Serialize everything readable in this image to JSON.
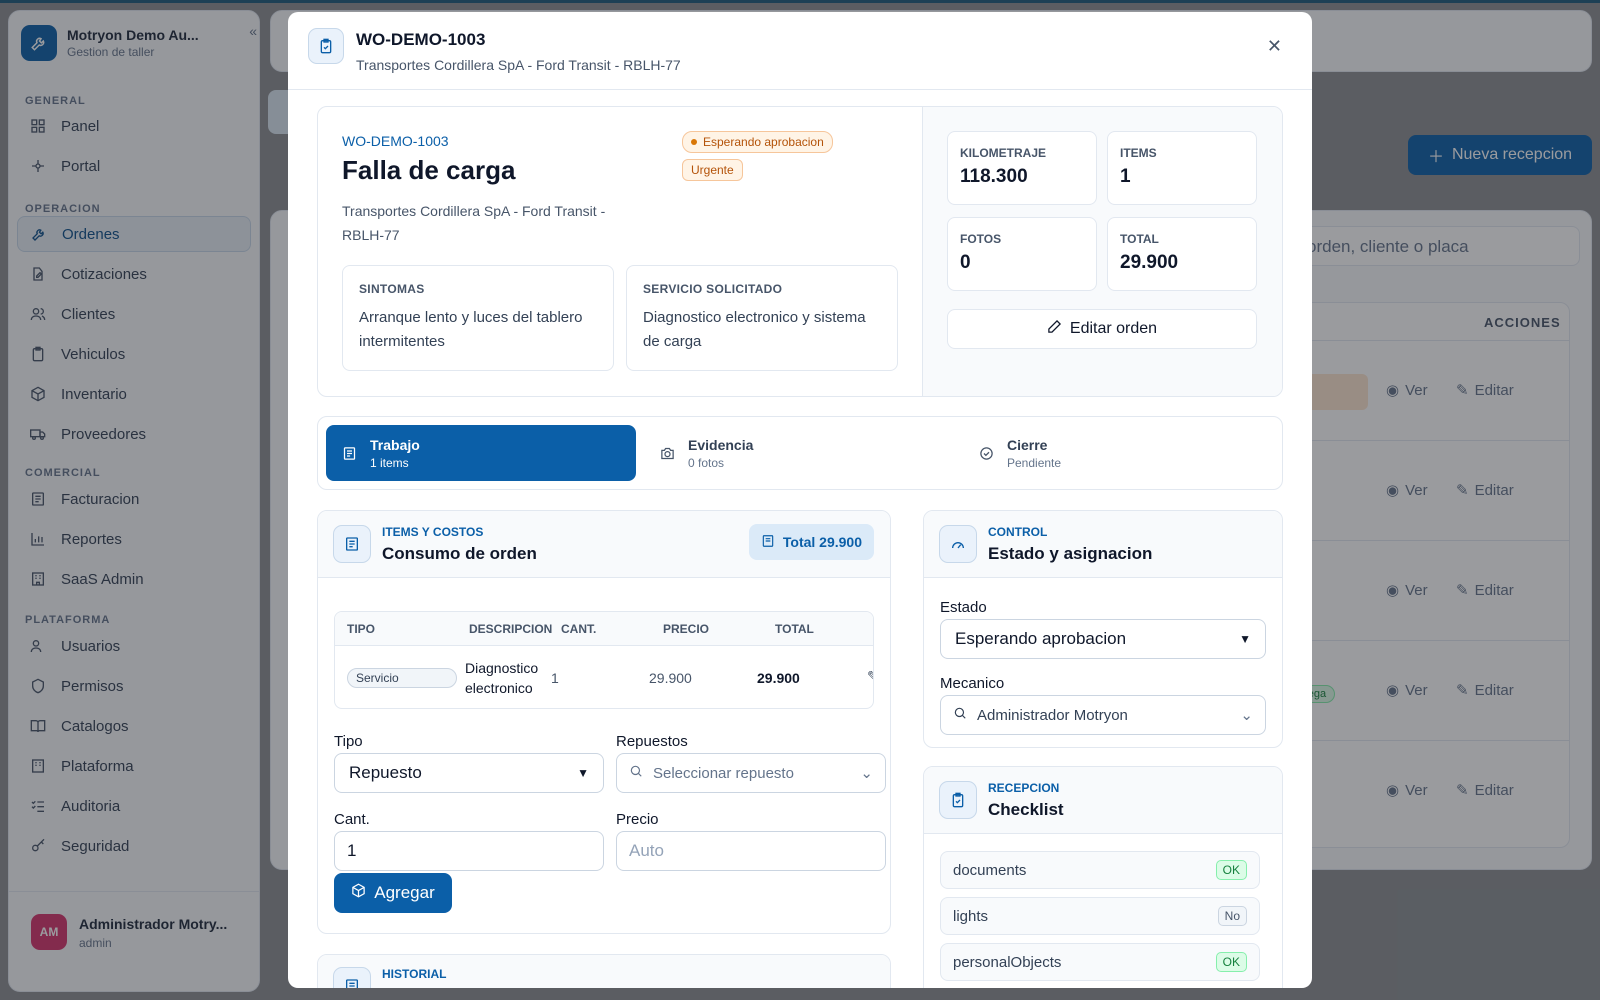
{
  "app": {
    "brand_title": "Motryon Demo Au...",
    "brand_subtitle": "Gestion de taller"
  },
  "sidebar": {
    "sections": [
      {
        "label": "GENERAL"
      },
      {
        "label": "OPERACION"
      },
      {
        "label": "COMERCIAL"
      },
      {
        "label": "PLATAFORMA"
      }
    ],
    "items": [
      {
        "label": "Panel",
        "icon": "grid-icon"
      },
      {
        "label": "Portal",
        "icon": "network-icon"
      },
      {
        "label": "Ordenes",
        "icon": "wrench-icon",
        "active": true
      },
      {
        "label": "Cotizaciones",
        "icon": "document-edit-icon"
      },
      {
        "label": "Clientes",
        "icon": "users-icon"
      },
      {
        "label": "Vehiculos",
        "icon": "clipboard-icon"
      },
      {
        "label": "Inventario",
        "icon": "box-icon"
      },
      {
        "label": "Proveedores",
        "icon": "truck-icon"
      },
      {
        "label": "Facturacion",
        "icon": "receipt-icon"
      },
      {
        "label": "Reportes",
        "icon": "bar-chart-icon"
      },
      {
        "label": "SaaS Admin",
        "icon": "building-icon"
      },
      {
        "label": "Usuarios",
        "icon": "users-icon"
      },
      {
        "label": "Permisos",
        "icon": "shield-icon"
      },
      {
        "label": "Catalogos",
        "icon": "book-icon"
      },
      {
        "label": "Plataforma",
        "icon": "building-icon"
      },
      {
        "label": "Auditoria",
        "icon": "list-check-icon"
      },
      {
        "label": "Seguridad",
        "icon": "key-icon"
      }
    ],
    "user": {
      "initials": "AM",
      "name": "Administrador Motry...",
      "role": "admin"
    }
  },
  "background": {
    "new_button": "Nueva recepcion",
    "search_placeholder": "orden, cliente o placa",
    "actions_header": "ACCIONES",
    "view_label": "Ver",
    "edit_label": "Editar",
    "green_badge": "trega"
  },
  "modal": {
    "title": "WO-DEMO-1003",
    "subtitle": "Transportes Cordillera SpA - Ford Transit - RBLH-77",
    "summary": {
      "code": "WO-DEMO-1003",
      "title": "Falla de carga",
      "description": "Transportes Cordillera SpA - Ford Transit - RBLH-77",
      "status_badge": "Esperando aprobacion",
      "priority_badge": "Urgente",
      "symptoms_label": "SINTOMAS",
      "symptoms_text": "Arranque lento y luces del tablero intermitentes",
      "service_label": "SERVICIO SOLICITADO",
      "service_text": "Diagnostico electronico y sistema de carga",
      "stats": {
        "km_label": "KILOMETRAJE",
        "km_value": "118.300",
        "items_label": "ITEMS",
        "items_value": "1",
        "photos_label": "FOTOS",
        "photos_value": "0",
        "total_label": "TOTAL",
        "total_value": "29.900"
      },
      "edit_button": "Editar orden"
    },
    "tabs": [
      {
        "label": "Trabajo",
        "sub": "1 items"
      },
      {
        "label": "Evidencia",
        "sub": "0 fotos"
      },
      {
        "label": "Cierre",
        "sub": "Pendiente"
      }
    ],
    "items_panel": {
      "kicker": "ITEMS Y COSTOS",
      "title": "Consumo de orden",
      "total_pill": "Total 29.900",
      "columns": [
        "TIPO",
        "DESCRIPCION",
        "CANT.",
        "PRECIO",
        "TOTAL"
      ],
      "rows": [
        {
          "tipo": "Servicio",
          "descripcion_1": "Diagnostico",
          "descripcion_2": "electronico",
          "cant": "1",
          "precio": "29.900",
          "total": "29.900"
        }
      ],
      "form": {
        "tipo_label": "Tipo",
        "tipo_value": "Repuesto",
        "repuestos_label": "Repuestos",
        "repuestos_placeholder": "Seleccionar repuesto",
        "cant_label": "Cant.",
        "cant_value": "1",
        "precio_label": "Precio",
        "precio_placeholder": "Auto",
        "add_button": "Agregar"
      }
    },
    "history_panel": {
      "kicker": "HISTORIAL"
    },
    "control_panel": {
      "kicker": "CONTROL",
      "title": "Estado y asignacion",
      "estado_label": "Estado",
      "estado_value": "Esperando aprobacion",
      "mecanico_label": "Mecanico",
      "mecanico_value": "Administrador Motryon"
    },
    "checklist_panel": {
      "kicker": "RECEPCION",
      "title": "Checklist",
      "items": [
        {
          "label": "documents",
          "status": "OK"
        },
        {
          "label": "lights",
          "status": "No"
        },
        {
          "label": "personalObjects",
          "status": "OK"
        }
      ]
    }
  }
}
